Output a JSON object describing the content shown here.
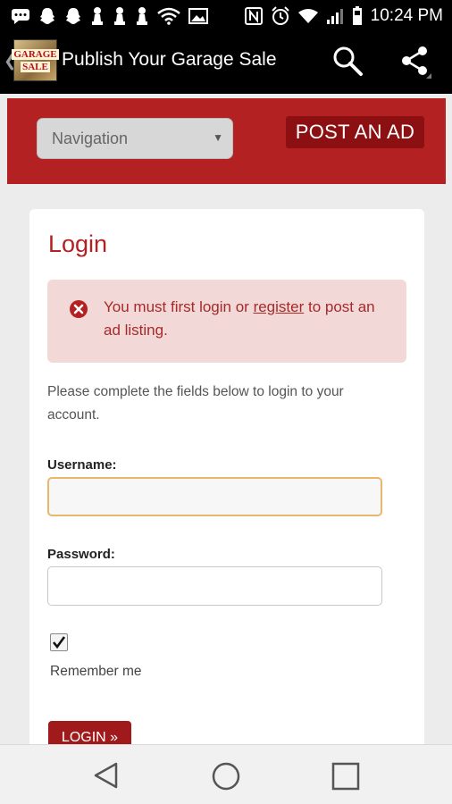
{
  "status_bar": {
    "time": "10:24 PM",
    "icons": [
      "message-icon",
      "ghost-icon",
      "ghost-icon",
      "chess-pawn-icon",
      "chess-pawn-icon",
      "chess-pawn-icon",
      "wifi-icon",
      "image-icon",
      "nfc-icon",
      "alarm-icon",
      "wifi-icon",
      "signal-icon",
      "battery-icon"
    ]
  },
  "app_bar": {
    "title": "Publish Your Garage Sale",
    "logo_text": [
      "GARAGE",
      "SALE"
    ],
    "icons": [
      "back-chevron-icon",
      "search-icon",
      "share-icon"
    ]
  },
  "site_header": {
    "navigation_select": "Navigation",
    "post_ad_label": "POST AN AD",
    "color": "#b42123"
  },
  "login": {
    "heading": "Login",
    "alert": {
      "text_before": "You must first login or ",
      "link": "register",
      "text_after": " to post an ad listing.",
      "icon": "error-circle-icon"
    },
    "intro": "Please complete the fields below to login to your account.",
    "username_label": "Username:",
    "username_value": "",
    "password_label": "Password:",
    "password_value": "",
    "remember_label": "Remember me",
    "remember_checked": true,
    "submit_label": "LOGIN »"
  },
  "nav_bar": {
    "icons": [
      "back-triangle-icon",
      "home-circle-icon",
      "recents-square-icon"
    ]
  }
}
